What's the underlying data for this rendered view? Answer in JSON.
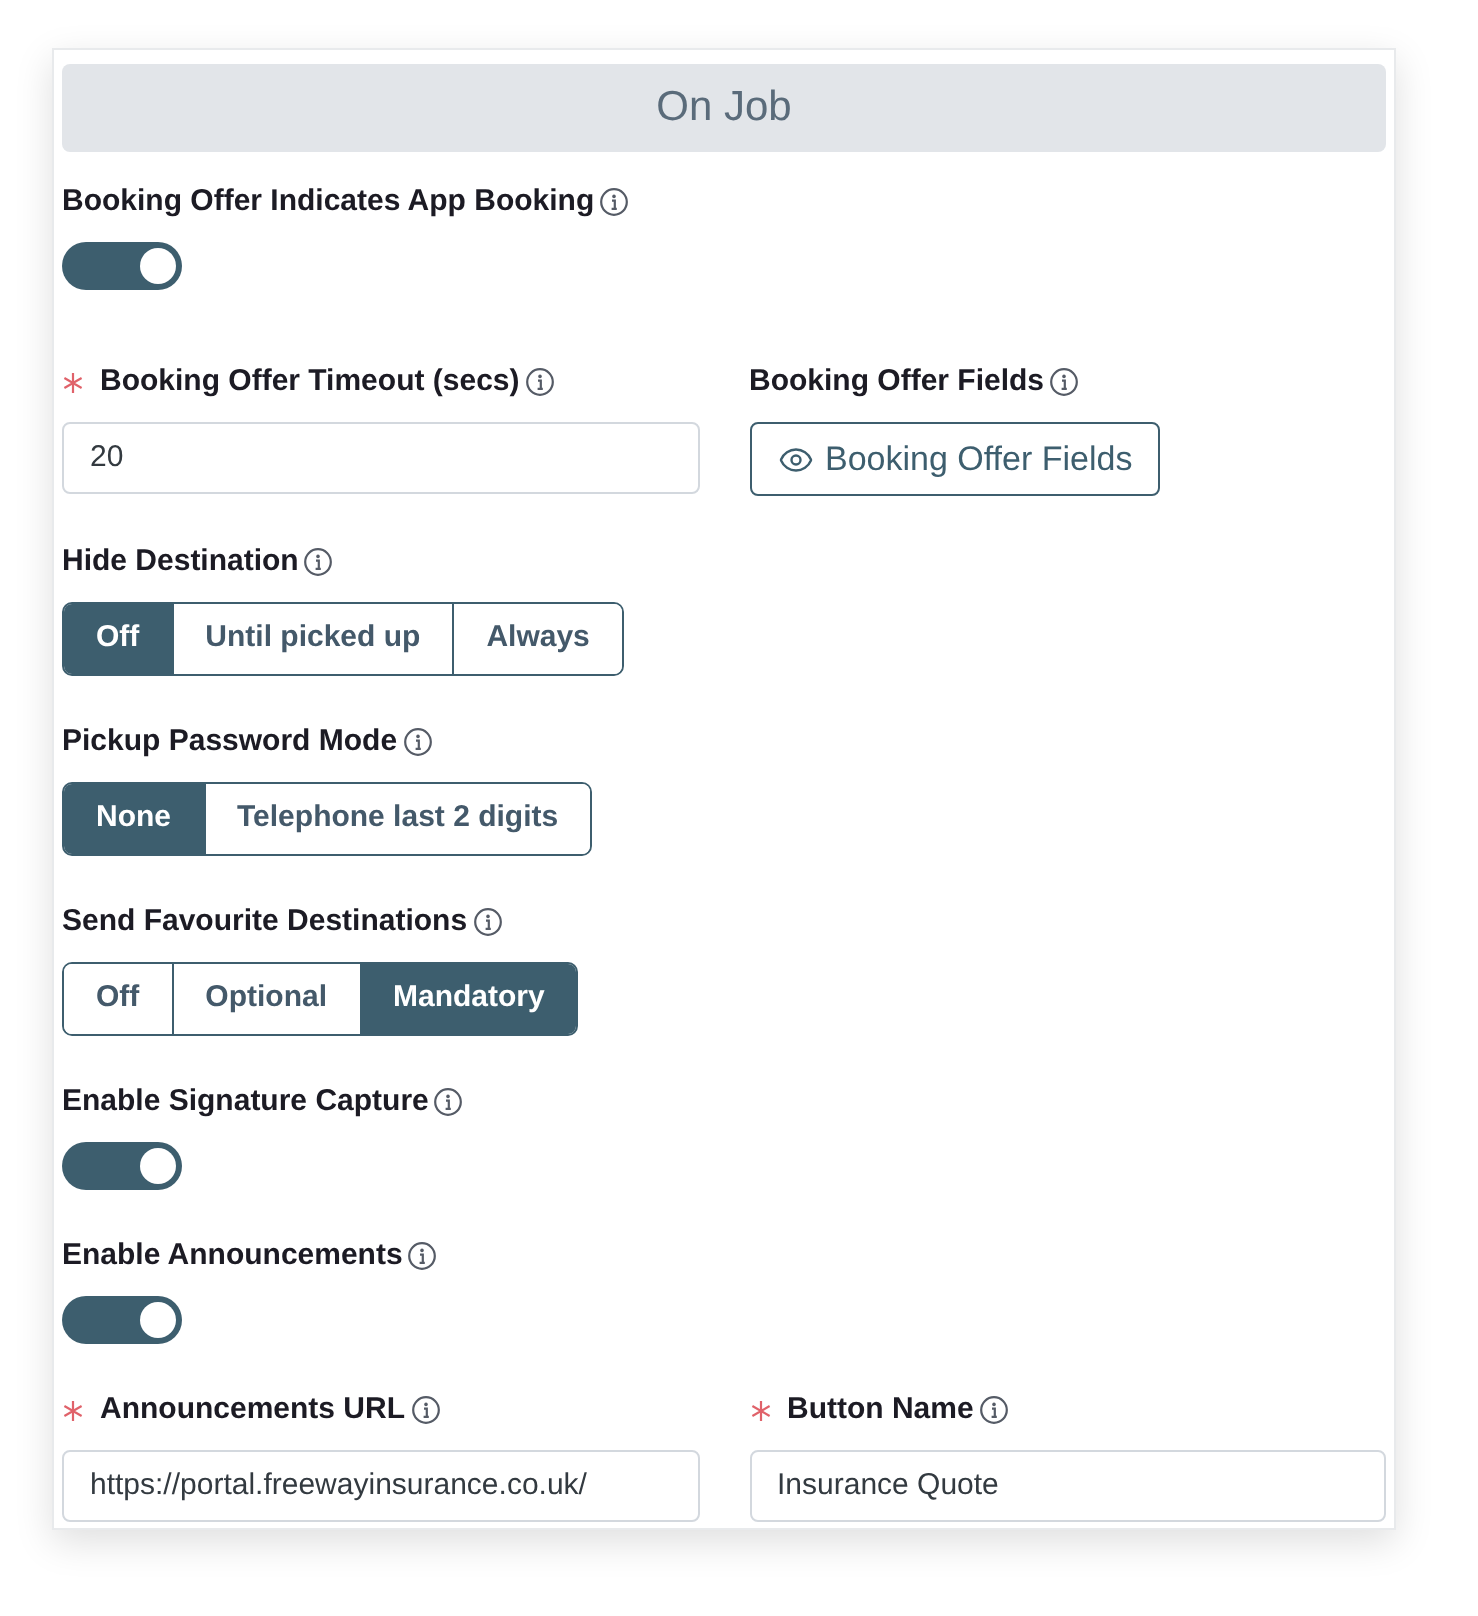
{
  "section": {
    "title": "On Job"
  },
  "fields": [
    {
      "kind": "toggle",
      "label": "Booking Offer Indicates App Booking",
      "required": false,
      "on": true
    },
    {
      "kind": "row",
      "items": [
        {
          "kind": "input",
          "label": "Booking Offer Timeout (secs)",
          "required": true,
          "value": "20"
        },
        {
          "kind": "button",
          "label": "Booking Offer Fields",
          "required": false,
          "button": "Booking Offer Fields"
        }
      ]
    },
    {
      "kind": "segmented",
      "label": "Hide Destination",
      "required": false,
      "options": [
        {
          "label": "Off",
          "selected": true
        },
        {
          "label": "Until picked up",
          "selected": false
        },
        {
          "label": "Always",
          "selected": false
        }
      ]
    },
    {
      "kind": "segmented",
      "label": "Pickup Password Mode",
      "required": false,
      "options": [
        {
          "label": "None",
          "selected": true
        },
        {
          "label": "Telephone last 2 digits",
          "selected": false
        }
      ]
    },
    {
      "kind": "segmented",
      "label": "Send Favourite Destinations",
      "required": false,
      "options": [
        {
          "label": "Off",
          "selected": false
        },
        {
          "label": "Optional",
          "selected": false
        },
        {
          "label": "Mandatory",
          "selected": true
        }
      ]
    },
    {
      "kind": "toggle",
      "label": "Enable Signature Capture",
      "required": false,
      "on": true
    },
    {
      "kind": "toggle",
      "label": "Enable Announcements",
      "required": false,
      "on": true
    },
    {
      "kind": "row",
      "items": [
        {
          "kind": "input",
          "label": "Announcements URL",
          "required": true,
          "value": "https://portal.freewayinsurance.co.uk/"
        },
        {
          "kind": "input",
          "label": "Button Name",
          "required": true,
          "value": "Insurance Quote"
        }
      ]
    }
  ]
}
